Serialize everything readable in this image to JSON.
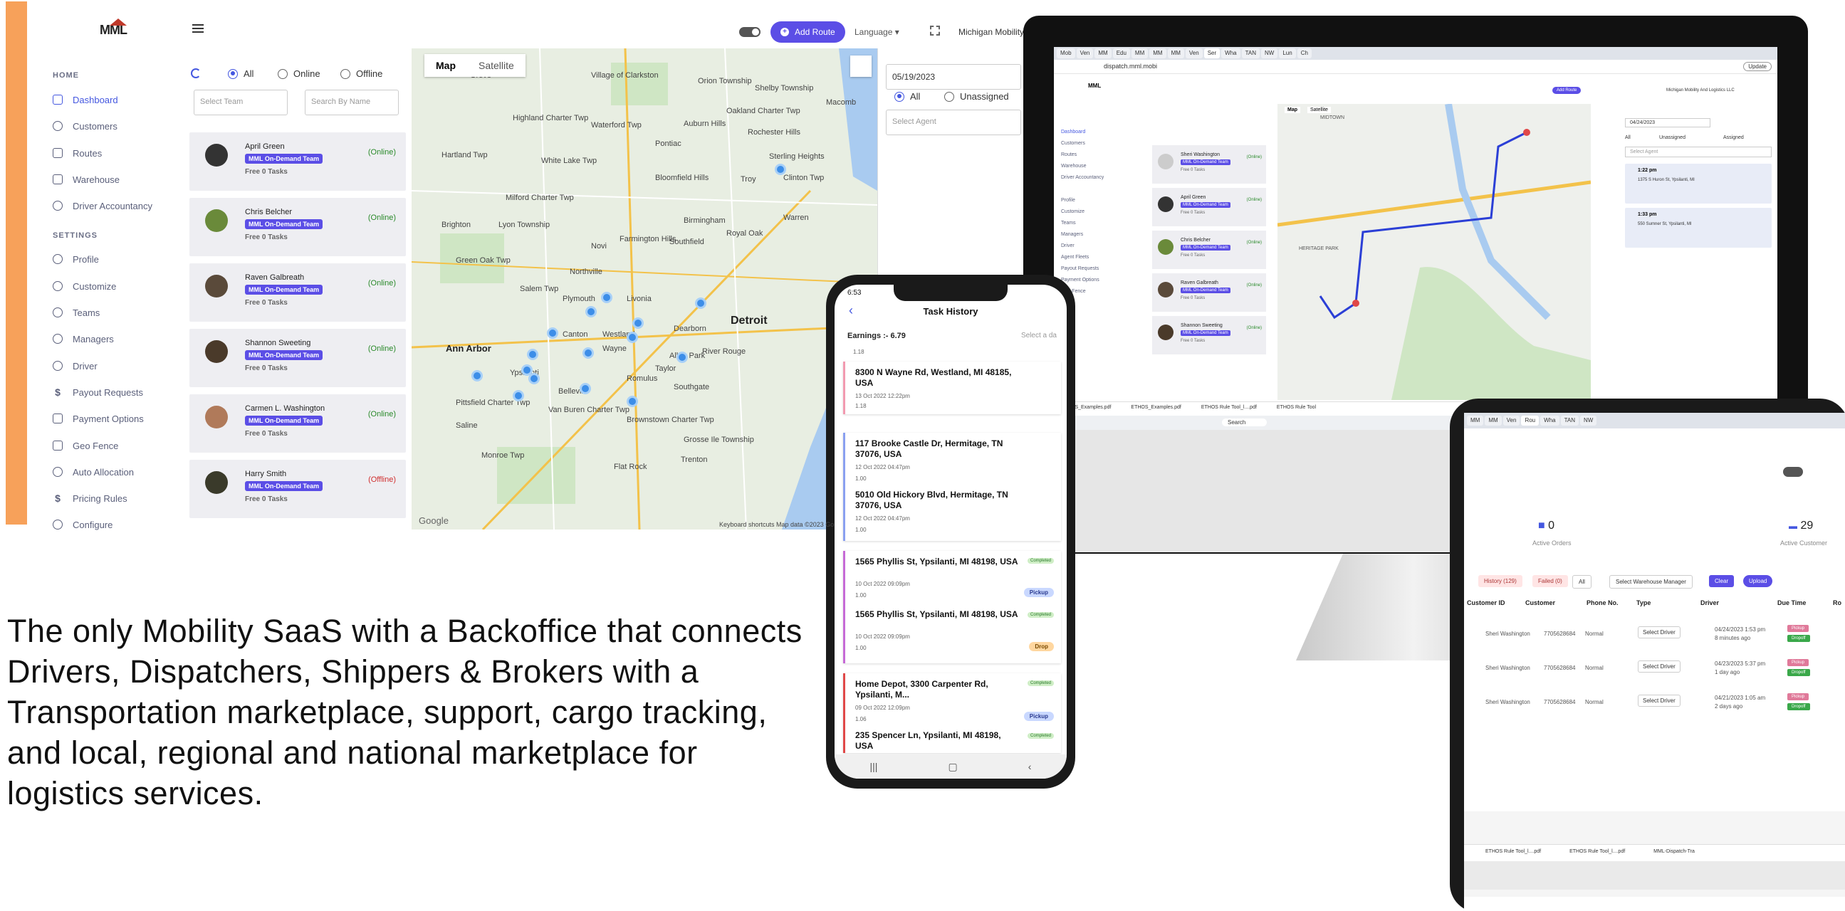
{
  "colors": {
    "accent": "#5b4ee6",
    "orange": "#f7a15a",
    "online": "#2a8a2a",
    "offline": "#d03030"
  },
  "dashboard": {
    "logo": "MML",
    "add_route": "Add Route",
    "language": "Language",
    "company": "Michigan Mobility",
    "sidebar": {
      "home_title": "HOME",
      "home_items": [
        "Dashboard",
        "Customers",
        "Routes",
        "Warehouse",
        "Driver Accountancy"
      ],
      "settings_title": "SETTINGS",
      "settings_items": [
        "Profile",
        "Customize",
        "Teams",
        "Managers",
        "Driver",
        "Payout Requests",
        "Payment Options",
        "Geo Fence",
        "Auto Allocation",
        "Pricing Rules",
        "Configure"
      ]
    },
    "filters": {
      "all": "All",
      "online": "Online",
      "offline": "Offline",
      "team_placeholder": "Select Team",
      "search_placeholder": "Search By Name"
    },
    "drivers": [
      {
        "name": "April Green",
        "team": "MML On-Demand Team",
        "tasks": "Free 0 Tasks",
        "status": "(Online)"
      },
      {
        "name": "Chris Belcher",
        "team": "MML On-Demand Team",
        "tasks": "Free 0 Tasks",
        "status": "(Online)"
      },
      {
        "name": "Raven Galbreath",
        "team": "MML On-Demand Team",
        "tasks": "Free 0 Tasks",
        "status": "(Online)"
      },
      {
        "name": "Shannon Sweeting",
        "team": "MML On-Demand Team",
        "tasks": "Free 0 Tasks",
        "status": "(Online)"
      },
      {
        "name": "Carmen L. Washington",
        "team": "MML On-Demand Team",
        "tasks": "Free 0 Tasks",
        "status": "(Online)"
      },
      {
        "name": "Harry Smith",
        "team": "MML On-Demand Team",
        "tasks": "Free 0 Tasks",
        "status": "(Offline)"
      }
    ],
    "map": {
      "tab_map": "Map",
      "tab_satellite": "Satellite",
      "cities": [
        "Grove",
        "Village of Clarkston",
        "Orion Township",
        "Oakland Charter Twp",
        "Auburn Hills",
        "Waterford Twp",
        "Pontiac",
        "Shelby Township",
        "Rochester Hills",
        "Macomb",
        "Highland Charter Twp",
        "White Lake Twp",
        "Sterling Heights",
        "Hartland Twp",
        "Milford Charter Twp",
        "Bloomfield Hills",
        "Troy",
        "Clinton Twp",
        "Brighton",
        "Lyon Township",
        "Novi",
        "Farmington Hills",
        "Birmingham",
        "Royal Oak",
        "Southfield",
        "Warren",
        "Green Oak Twp",
        "Northville",
        "Salem Twp",
        "Plymouth",
        "Livonia",
        "Detroit",
        "Dearborn",
        "Ann Arbor",
        "Canton",
        "Westland",
        "Wayne",
        "Allen Park",
        "Ypsilanti",
        "Romulus",
        "River Rouge",
        "Belleville",
        "Taylor",
        "Southgate",
        "Saline",
        "Pittsfield Charter Twp",
        "Van Buren Charter Twp",
        "Brownstown Charter Twp",
        "Monroe Twp",
        "Grosse Ile Township",
        "Flat Rock",
        "Trenton"
      ],
      "footer": "Keyboard shortcuts  Map data ©2023 Go",
      "google": "Google"
    },
    "task_panel": {
      "date": "05/19/2023",
      "all": "All",
      "unassigned": "Unassigned",
      "agent_placeholder": "Select Agent"
    }
  },
  "hero_text": "The only Mobility SaaS with a Backoffice that connects Drivers, Dispatchers, Shippers & Brokers with a Transportation marketplace, support, cargo tracking, and local, regional and national marketplace for logistics services.",
  "imac": {
    "tabs": [
      "Mob",
      "Ven",
      "MM",
      "Edu",
      "MM",
      "MM",
      "MM",
      "Ven",
      "Ser",
      "Wha",
      "TAN",
      "NW",
      "Lun",
      "Ch"
    ],
    "url": "dispatch.mml.mobi",
    "update": "Update",
    "company": "Michigan Mobility And Logistics LLC",
    "nav": [
      "Dashboard",
      "Customers",
      "Routes",
      "Warehouse",
      "Driver Accountancy",
      "Profile",
      "Customize",
      "Teams",
      "Managers",
      "Driver",
      "Agent Fleets",
      "Payout Requests",
      "Payment Options",
      "Geo Fence"
    ],
    "drivers": [
      {
        "name": "Sheri Washington",
        "team": "MML On-Demand Team",
        "tasks": "Free 0 Tasks",
        "status": "(Online)"
      },
      {
        "name": "April Green",
        "team": "MML On-Demand Team",
        "tasks": "Free 0 Tasks",
        "status": "(Online)"
      },
      {
        "name": "Chris Belcher",
        "team": "MML On-Demand Team",
        "tasks": "Free 0 Tasks",
        "status": "(Online)"
      },
      {
        "name": "Raven Galbreath",
        "team": "MML On-Demand Team",
        "tasks": "Free 0 Tasks",
        "status": "(Online)"
      },
      {
        "name": "Shannon Sweeting",
        "team": "MML On-Demand Team",
        "tasks": "Free 0 Tasks",
        "status": "(Online)"
      }
    ],
    "map_labels": [
      "MIDTOWN",
      "HERITAGE PARK"
    ],
    "task_date": "04/24/2023",
    "task_filters": [
      "All",
      "Unassigned",
      "Assigned"
    ],
    "tasks": [
      {
        "time": "1:22 pm",
        "addr": "1375 S Huron St, Ypsilanti, MI"
      },
      {
        "time": "1:33 pm",
        "addr": "550 Sumner St, Ypsilanti, MI"
      }
    ],
    "downloads": [
      "ETHOS_Examples.pdf",
      "ETHOS_Examples.pdf",
      "ETHOS Rule Tool_l....pdf",
      "ETHOS Rule Tool"
    ],
    "search": "Search"
  },
  "phone": {
    "time": "6:53",
    "title": "Task History",
    "earnings": "Earnings :- 6.79",
    "select": "Select a da",
    "tasks": [
      {
        "addr": "8300 N Wayne Rd, Westland, MI 48185, USA",
        "time": "13 Oct 2022 12:22pm",
        "dist": "1.18"
      },
      {
        "addr": "117 Brooke Castle Dr, Hermitage, TN 37076, USA",
        "time": "12 Oct 2022 04:47pm",
        "dist": "1.00"
      },
      {
        "addr": "5010 Old Hickory Blvd, Hermitage, TN 37076, USA",
        "time": "12 Oct 2022 04:47pm",
        "dist": "1.00"
      },
      {
        "addr": "1565 Phyllis St, Ypsilanti, MI 48198, USA",
        "time": "10 Oct 2022 09:09pm",
        "dist": "1.00",
        "pill": "Pickup"
      },
      {
        "addr": "1565 Phyllis St, Ypsilanti, MI 48198, USA",
        "time": "10 Oct 2022 09:09pm",
        "dist": "1.00",
        "pill": "Drop"
      },
      {
        "addr": "Home Depot, 3300 Carpenter Rd, Ypsilanti, M...",
        "time": "09 Oct 2022 12:09pm",
        "dist": "1.06",
        "pill": "Pickup"
      },
      {
        "addr": "235 Spencer Ln, Ypsilanti, MI 48198, USA",
        "time": "",
        "dist": ""
      }
    ],
    "top_dist": "1.18",
    "completed": "Completed"
  },
  "tablet": {
    "tabs": [
      "MM",
      "MM",
      "Ven",
      "Rou",
      "Wha",
      "TAN",
      "NW"
    ],
    "active_orders": "0",
    "active_orders_label": "Active Orders",
    "active_customers": "29",
    "active_customers_label": "Active Customer",
    "filters": [
      "History (129)",
      "Failed (0)",
      "All",
      "Select Warehouse Manager",
      "Clear",
      "Upload"
    ],
    "headers": [
      "Customer ID",
      "Customer",
      "Phone No.",
      "Type",
      "Driver",
      "Due Time",
      "Ro"
    ],
    "rows": [
      {
        "customer": "Sheri Washington",
        "phone": "7705628684",
        "type": "Normal",
        "driver": "Select Driver",
        "due": "04/24/2023 1:53 pm",
        "ago": "8 minutes ago"
      },
      {
        "customer": "Sheri Washington",
        "phone": "7705628684",
        "type": "Normal",
        "driver": "Select Driver",
        "due": "04/23/2023 5:37 pm",
        "ago": "1 day ago"
      },
      {
        "customer": "Sheri Washington",
        "phone": "7705628684",
        "type": "Normal",
        "driver": "Select Driver",
        "due": "04/21/2023 1:05 am",
        "ago": "2 days ago"
      }
    ],
    "tags": [
      "Pickup",
      "Dropoff"
    ],
    "downloads": [
      "ETHOS Rule Tool_l....pdf",
      "ETHOS Rule Tool_l....pdf",
      "MML-Dispatch-Tra"
    ]
  }
}
